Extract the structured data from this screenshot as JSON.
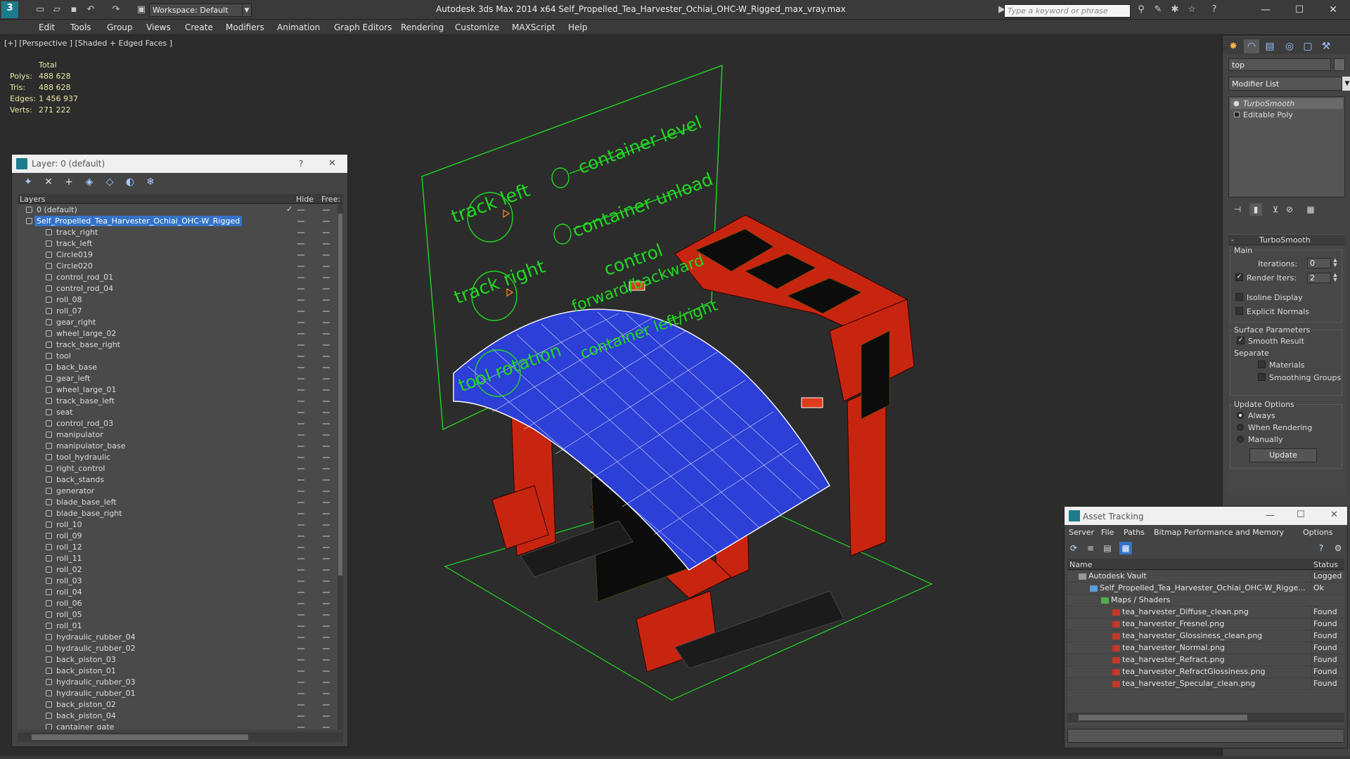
{
  "app": {
    "title": "Autodesk 3ds Max  2014 x64     Self_Propelled_Tea_Harvester_Ochiai_OHC-W_Rigged_max_vray.max",
    "workspace": "Workspace: Default",
    "search_placeholder": "Type a keyword or phrase"
  },
  "menu": [
    "Edit",
    "Tools",
    "Group",
    "Views",
    "Create",
    "Modifiers",
    "Animation",
    "Graph Editors",
    "Rendering",
    "Customize",
    "MAXScript",
    "Help"
  ],
  "viewport": {
    "label": "[+] [Perspective ] [Shaded + Edged Faces ]",
    "stats_header": "Total",
    "stats": [
      {
        "key": "Polys:",
        "value": "488 628"
      },
      {
        "key": "Tris:",
        "value": "488 628"
      },
      {
        "key": "Edges:",
        "value": "1 456 937"
      },
      {
        "key": "Verts:",
        "value": "271 222"
      }
    ],
    "board_labels": [
      "track left",
      "container level",
      "container unload",
      "track right",
      "control",
      "forward/backward",
      "container left/right",
      "tool rotation"
    ]
  },
  "layer_dialog": {
    "title": "Layer: 0 (default)",
    "help": "?",
    "close": "✕",
    "col_layers": "Layers",
    "col_hide": "Hide",
    "col_freeze": "Free:",
    "rows": [
      {
        "name": "0 (default)",
        "level": 0,
        "selected": false,
        "checked": true
      },
      {
        "name": "Self_Propelled_Tea_Harvester_Ochiai_OHC-W_Rigged",
        "level": 0,
        "selected": true,
        "checked": false
      },
      {
        "name": "track_right",
        "level": 1
      },
      {
        "name": "track_left",
        "level": 1
      },
      {
        "name": "Circle019",
        "level": 1
      },
      {
        "name": "Circle020",
        "level": 1
      },
      {
        "name": "control_rod_01",
        "level": 1
      },
      {
        "name": "control_rod_04",
        "level": 1
      },
      {
        "name": "roll_08",
        "level": 1
      },
      {
        "name": "roll_07",
        "level": 1
      },
      {
        "name": "gear_right",
        "level": 1
      },
      {
        "name": "wheel_large_02",
        "level": 1
      },
      {
        "name": "track_base_right",
        "level": 1
      },
      {
        "name": "tool",
        "level": 1
      },
      {
        "name": "back_base",
        "level": 1
      },
      {
        "name": "gear_left",
        "level": 1
      },
      {
        "name": "wheel_large_01",
        "level": 1
      },
      {
        "name": "track_base_left",
        "level": 1
      },
      {
        "name": "seat",
        "level": 1
      },
      {
        "name": "control_rod_03",
        "level": 1
      },
      {
        "name": "manipulator",
        "level": 1
      },
      {
        "name": "manipulator_base",
        "level": 1
      },
      {
        "name": "tool_hydraulic",
        "level": 1
      },
      {
        "name": "right_control",
        "level": 1
      },
      {
        "name": "back_stands",
        "level": 1
      },
      {
        "name": "generator",
        "level": 1
      },
      {
        "name": "blade_base_left",
        "level": 1
      },
      {
        "name": "blade_base_right",
        "level": 1
      },
      {
        "name": "roll_10",
        "level": 1
      },
      {
        "name": "roll_09",
        "level": 1
      },
      {
        "name": "roll_12",
        "level": 1
      },
      {
        "name": "roll_11",
        "level": 1
      },
      {
        "name": "roll_02",
        "level": 1
      },
      {
        "name": "roll_03",
        "level": 1
      },
      {
        "name": "roll_04",
        "level": 1
      },
      {
        "name": "roll_06",
        "level": 1
      },
      {
        "name": "roll_05",
        "level": 1
      },
      {
        "name": "roll_01",
        "level": 1
      },
      {
        "name": "hydraulic_rubber_04",
        "level": 1
      },
      {
        "name": "hydraulic_rubber_02",
        "level": 1
      },
      {
        "name": "back_piston_03",
        "level": 1
      },
      {
        "name": "back_piston_01",
        "level": 1
      },
      {
        "name": "hydraulic_rubber_03",
        "level": 1
      },
      {
        "name": "hydraulic_rubber_01",
        "level": 1
      },
      {
        "name": "back_piston_02",
        "level": 1
      },
      {
        "name": "back_piston_04",
        "level": 1
      },
      {
        "name": "cantainer_gate",
        "level": 1
      }
    ]
  },
  "command_panel": {
    "object_name": "top",
    "modifier_list": "Modifier List",
    "stack": [
      "TurboSmooth",
      "Editable Poly"
    ],
    "rollout_title": "TurboSmooth",
    "main_group": "Main",
    "iterations_label": "Iterations:",
    "iterations_value": "0",
    "render_iters_label": "Render Iters:",
    "render_iters_value": "2",
    "render_iters_checked": true,
    "isoline_label": "Isoline Display",
    "explicit_normals_label": "Explicit Normals",
    "surface_group": "Surface Parameters",
    "smooth_result_label": "Smooth Result",
    "separate_label": "Separate",
    "materials_label": "Materials",
    "smoothing_groups_label": "Smoothing Groups",
    "update_group": "Update Options",
    "update_options": [
      "Always",
      "When Rendering",
      "Manually"
    ],
    "update_selected": "Always",
    "update_button": "Update"
  },
  "asset_tracking": {
    "title": "Asset Tracking",
    "menu": [
      "Server",
      "File",
      "Paths",
      "Bitmap Performance and Memory",
      "Options"
    ],
    "col_name": "Name",
    "col_status": "Status",
    "rows": [
      {
        "name": "Autodesk Vault",
        "status": "Logged Out",
        "indent": 0,
        "icon": "vault"
      },
      {
        "name": "Self_Propelled_Tea_Harvester_Ochiai_OHC-W_Rigge...",
        "status": "Ok",
        "indent": 1,
        "icon": "max"
      },
      {
        "name": "Maps / Shaders",
        "status": "",
        "indent": 2,
        "icon": "maps"
      },
      {
        "name": "tea_harvester_Diffuse_clean.png",
        "status": "Found",
        "indent": 3,
        "icon": "png"
      },
      {
        "name": "tea_harvester_Fresnel.png",
        "status": "Found",
        "indent": 3,
        "icon": "png"
      },
      {
        "name": "tea_harvester_Glossiness_clean.png",
        "status": "Found",
        "indent": 3,
        "icon": "png"
      },
      {
        "name": "tea_harvester_Normal.png",
        "status": "Found",
        "indent": 3,
        "icon": "png"
      },
      {
        "name": "tea_harvester_Refract.png",
        "status": "Found",
        "indent": 3,
        "icon": "png"
      },
      {
        "name": "tea_harvester_RefractGlossiness.png",
        "status": "Found",
        "indent": 3,
        "icon": "png"
      },
      {
        "name": "tea_harvester_Specular_clean.png",
        "status": "Found",
        "indent": 3,
        "icon": "png"
      }
    ]
  },
  "colors": {
    "accent": "#3572c6",
    "stats_text": "#e8e8a0",
    "rig_green": "#1fd81f",
    "machine_red": "#d42a10",
    "mesh_blue": "#2c3fd6"
  }
}
